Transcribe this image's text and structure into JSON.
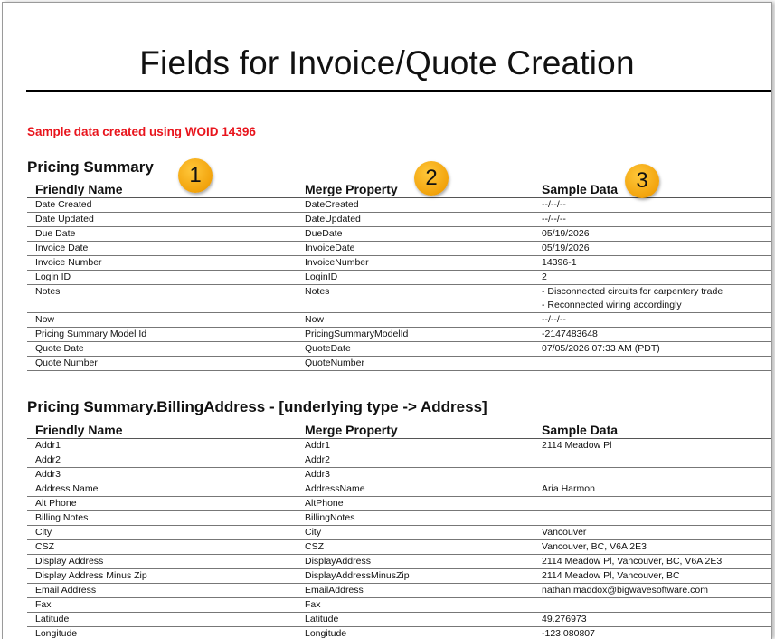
{
  "document": {
    "title": "Fields for Invoice/Quote Creation",
    "sample_note": "Sample data created using WOID 14396"
  },
  "badges": [
    "1",
    "2",
    "3"
  ],
  "pricing_summary": {
    "title": "Pricing Summary",
    "columns": [
      "Friendly Name",
      "Merge Property",
      "Sample Data"
    ],
    "rows": [
      {
        "name": "Date Created",
        "property": "DateCreated",
        "sample": [
          "--/--/--"
        ]
      },
      {
        "name": "Date Updated",
        "property": "DateUpdated",
        "sample": [
          "--/--/--"
        ]
      },
      {
        "name": "Due Date",
        "property": "DueDate",
        "sample": [
          "05/19/2026"
        ]
      },
      {
        "name": "Invoice Date",
        "property": "InvoiceDate",
        "sample": [
          "05/19/2026"
        ]
      },
      {
        "name": "Invoice Number",
        "property": "InvoiceNumber",
        "sample": [
          "14396-1"
        ]
      },
      {
        "name": "Login ID",
        "property": "LoginID",
        "sample": [
          "2"
        ]
      },
      {
        "name": "Notes",
        "property": "Notes",
        "sample": [
          "- Disconnected circuits for carpentery trade",
          "- Reconnected wiring accordingly"
        ]
      },
      {
        "name": "Now",
        "property": "Now",
        "sample": [
          "--/--/--"
        ]
      },
      {
        "name": "Pricing Summary Model Id",
        "property": "PricingSummaryModelId",
        "sample": [
          "-2147483648"
        ]
      },
      {
        "name": "Quote Date",
        "property": "QuoteDate",
        "sample": [
          "07/05/2026 07:33 AM (PDT)"
        ]
      },
      {
        "name": "Quote Number",
        "property": "QuoteNumber",
        "sample": [
          ""
        ]
      }
    ]
  },
  "billing_address": {
    "title": "Pricing Summary.BillingAddress - [underlying type -> Address]",
    "columns": [
      "Friendly Name",
      "Merge Property",
      "Sample Data"
    ],
    "rows": [
      {
        "name": "Addr1",
        "property": "Addr1",
        "sample": [
          "2114 Meadow Pl"
        ]
      },
      {
        "name": "Addr2",
        "property": "Addr2",
        "sample": [
          ""
        ]
      },
      {
        "name": "Addr3",
        "property": "Addr3",
        "sample": [
          ""
        ]
      },
      {
        "name": "Address Name",
        "property": "AddressName",
        "sample": [
          "Aria Harmon"
        ]
      },
      {
        "name": "Alt Phone",
        "property": "AltPhone",
        "sample": [
          ""
        ]
      },
      {
        "name": "Billing Notes",
        "property": "BillingNotes",
        "sample": [
          ""
        ]
      },
      {
        "name": "City",
        "property": "City",
        "sample": [
          "Vancouver"
        ]
      },
      {
        "name": "CSZ",
        "property": "CSZ",
        "sample": [
          "Vancouver, BC, V6A 2E3"
        ]
      },
      {
        "name": "Display Address",
        "property": "DisplayAddress",
        "sample": [
          "2114 Meadow Pl, Vancouver, BC, V6A 2E3"
        ]
      },
      {
        "name": "Display Address Minus Zip",
        "property": "DisplayAddressMinusZip",
        "sample": [
          "2114 Meadow Pl, Vancouver, BC"
        ]
      },
      {
        "name": "Email Address",
        "property": "EmailAddress",
        "sample": [
          "nathan.maddox@bigwavesoftware.com"
        ]
      },
      {
        "name": "Fax",
        "property": "Fax",
        "sample": [
          ""
        ]
      },
      {
        "name": "Latitude",
        "property": "Latitude",
        "sample": [
          "49.276973"
        ]
      },
      {
        "name": "Longitude",
        "property": "Longitude",
        "sample": [
          "-123.080807"
        ]
      }
    ]
  }
}
